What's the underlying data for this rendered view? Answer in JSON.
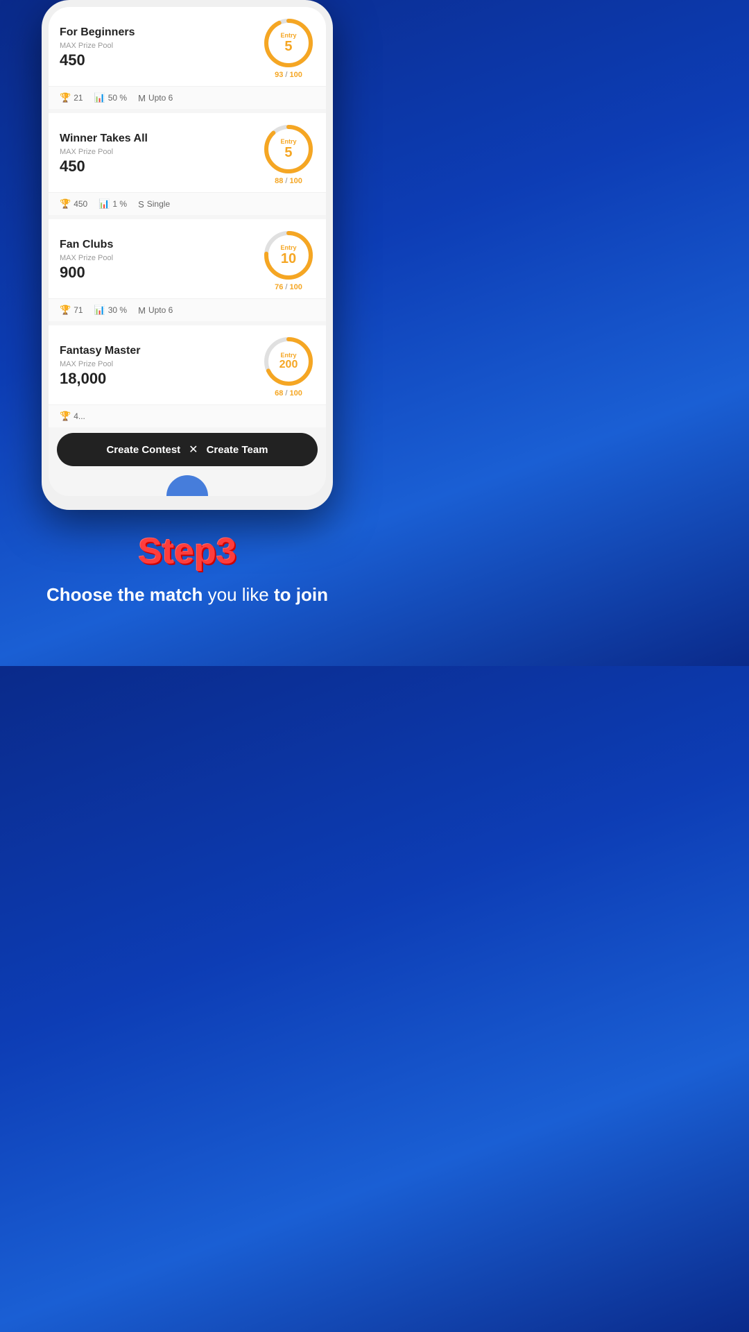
{
  "contests": [
    {
      "id": "for-beginners",
      "title": "For Beginners",
      "label": "MAX Prize Pool",
      "prize": "450",
      "entry": "5",
      "filled": 93,
      "total": 100,
      "stats": [
        {
          "icon": "🏆",
          "value": "21"
        },
        {
          "icon": "📊",
          "value": "50 %"
        },
        {
          "icon": "M",
          "value": "Upto 6"
        }
      ]
    },
    {
      "id": "winner-takes-all",
      "title": "Winner Takes All",
      "label": "MAX Prize Pool",
      "prize": "450",
      "entry": "5",
      "filled": 88,
      "total": 100,
      "stats": [
        {
          "icon": "🏆",
          "value": "450"
        },
        {
          "icon": "📊",
          "value": "1 %"
        },
        {
          "icon": "S",
          "value": "Single"
        }
      ]
    },
    {
      "id": "fan-clubs",
      "title": "Fan Clubs",
      "label": "MAX Prize Pool",
      "prize": "900",
      "entry": "10",
      "filled": 76,
      "total": 100,
      "stats": [
        {
          "icon": "🏆",
          "value": "71"
        },
        {
          "icon": "📊",
          "value": "30 %"
        },
        {
          "icon": "M",
          "value": "Upto 6"
        }
      ]
    },
    {
      "id": "fantasy-master",
      "title": "Fantasy Master",
      "label": "MAX Prize Pool",
      "prize": "18,000",
      "entry": "200",
      "filled": 68,
      "total": 100,
      "stats": [
        {
          "icon": "🏆",
          "value": "4..."
        },
        {
          "icon": "📊",
          "value": ""
        },
        {
          "icon": "",
          "value": ""
        }
      ]
    }
  ],
  "bottomBar": {
    "createContest": "Create Contest",
    "divider": "✕",
    "createTeam": "Create Team"
  },
  "step": {
    "title": "Step3",
    "descStrong1": "Choose the match",
    "descNormal": " you like ",
    "descStrong2": "to join"
  }
}
